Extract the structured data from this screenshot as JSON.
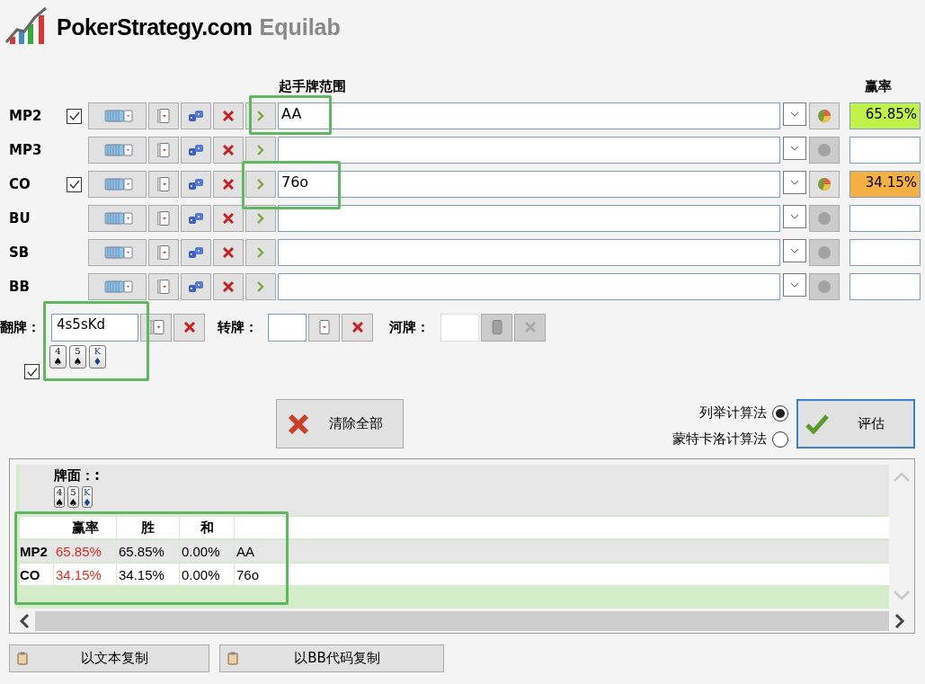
{
  "logo": {
    "brand": "PokerStrategy.com",
    "product": "Equilab"
  },
  "range_header": "起手牌范围",
  "equity_header": "赢率",
  "players": [
    {
      "name": "MP2",
      "checked": true,
      "active": true,
      "range": "AA",
      "equity": "65.85%",
      "color": "#c0f24a"
    },
    {
      "name": "MP3",
      "checked": false,
      "active": false
    },
    {
      "name": "CO",
      "checked": true,
      "active": true,
      "range": "76o",
      "equity": "34.15%",
      "color": "#f4b042"
    },
    {
      "name": "BU",
      "checked": false,
      "active": false
    },
    {
      "name": "SB",
      "checked": false,
      "active": false
    },
    {
      "name": "BB",
      "checked": false,
      "active": false
    }
  ],
  "board": {
    "flop_label": "翻牌：",
    "flop": "4s5sKd",
    "turn_label": "转牌：",
    "river_label": "河牌：",
    "river_disabled": true,
    "show_cards": true,
    "cards": [
      {
        "rank": "4",
        "suit": "♠",
        "color": "#000000"
      },
      {
        "rank": "5",
        "suit": "♠",
        "color": "#000000"
      },
      {
        "rank": "K",
        "suit": "♦",
        "color": "#1a3f8c"
      }
    ]
  },
  "clear_button": "清除全部",
  "evaluate_button": "评估",
  "methods": [
    {
      "label": "列举计算法",
      "selected": true
    },
    {
      "label": "蒙特卡洛计算法",
      "selected": false
    }
  ],
  "results": {
    "board_label": "牌面：:",
    "cards": [
      {
        "rank": "4",
        "suit": "♠",
        "color": "#000000"
      },
      {
        "rank": "5",
        "suit": "♠",
        "color": "#000000"
      },
      {
        "rank": "K",
        "suit": "♦",
        "color": "#1a3f8c"
      }
    ],
    "columns": [
      "赢率",
      "胜",
      "和"
    ],
    "rows": [
      {
        "player": "MP2",
        "equity": "65.85%",
        "win": "65.85%",
        "tie": "0.00%",
        "hand": "AA"
      },
      {
        "player": "CO",
        "equity": "34.15%",
        "win": "34.15%",
        "tie": "0.00%",
        "hand": "76o"
      }
    ]
  },
  "copy_buttons": [
    "以文本复制",
    "以BB代码复制"
  ]
}
